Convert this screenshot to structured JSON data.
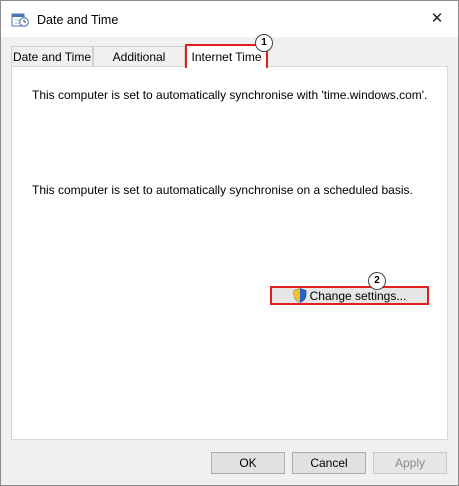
{
  "window": {
    "title": "Date and Time",
    "close_glyph": "✕",
    "icon": "calendar-clock-icon"
  },
  "tabs": [
    {
      "label": "Date and Time",
      "active": false
    },
    {
      "label": "Additional Clocks",
      "active": false
    },
    {
      "label": "Internet Time",
      "active": true
    }
  ],
  "panel": {
    "sync_server_text": "This computer is set to automatically synchronise with 'time.windows.com'.",
    "schedule_text": "This computer is set to automatically synchronise on a scheduled basis.",
    "change_settings_label": "Change settings..."
  },
  "annotations": {
    "badge1": "1",
    "badge2": "2",
    "highlight_color": "#e02020"
  },
  "footer": {
    "ok_label": "OK",
    "cancel_label": "Cancel",
    "apply_label": "Apply"
  }
}
